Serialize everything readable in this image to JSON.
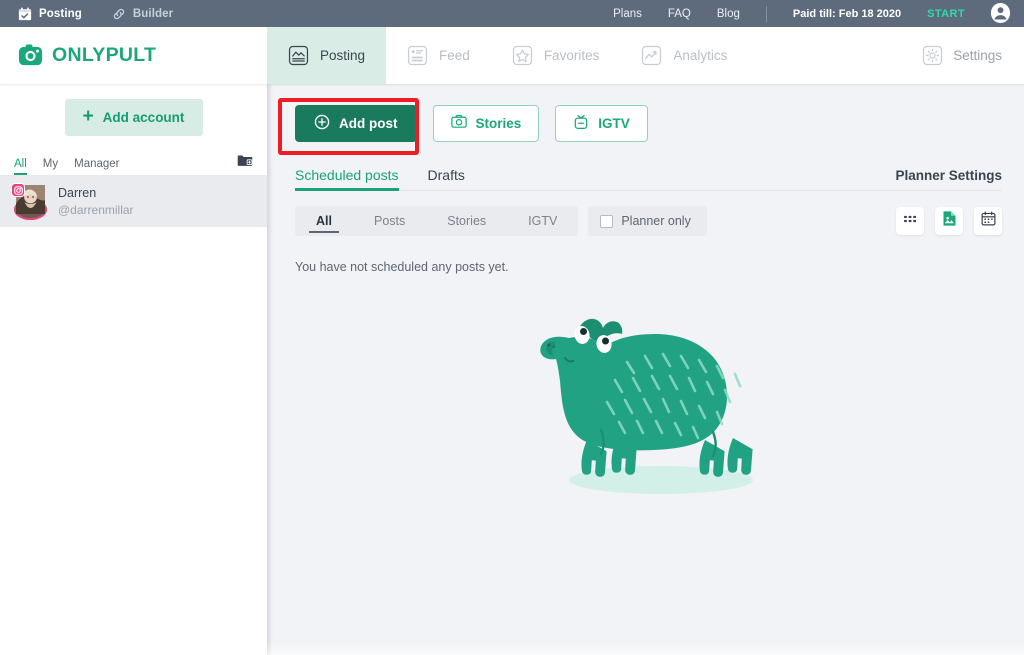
{
  "topbar": {
    "left_items": [
      {
        "label": "Posting",
        "icon": "calendar-check-icon",
        "active": true
      },
      {
        "label": "Builder",
        "icon": "link-chain-icon",
        "active": false
      }
    ],
    "links": [
      "Plans",
      "FAQ",
      "Blog"
    ],
    "plans_label": "Plans",
    "faq_label": "FAQ",
    "blog_label": "Blog",
    "paid_till": "Paid till: Feb 18 2020",
    "start_label": "START",
    "avatar_icon": "user-circle-icon",
    "bg_color": "#5d6b7d",
    "start_color": "#2fdca6"
  },
  "brand": {
    "name": "ONLYPULT",
    "icon": "instagram-camera-icon",
    "color": "#1aa87a"
  },
  "nav": {
    "tabs": [
      {
        "label": "Posting",
        "icon": "chart-frame-icon",
        "active": true
      },
      {
        "label": "Feed",
        "icon": "feed-list-icon",
        "active": false
      },
      {
        "label": "Favorites",
        "icon": "star-frame-icon",
        "active": false
      },
      {
        "label": "Analytics",
        "icon": "trend-line-icon",
        "active": false
      }
    ],
    "settings": {
      "label": "Settings",
      "icon": "gear-icon"
    },
    "active_bg": "#d9ece6"
  },
  "sidebar": {
    "add_account_label": "Add account",
    "add_account_icon": "plus-icon",
    "filter_tabs": [
      {
        "label": "All",
        "active": true
      },
      {
        "label": "My",
        "active": false
      },
      {
        "label": "Manager",
        "active": false
      }
    ],
    "folder_icon": "folder-add-icon",
    "accounts": [
      {
        "name": "Darren",
        "handle": "@darrenmillar",
        "network_icon": "instagram-badge-icon",
        "selected": true
      }
    ]
  },
  "main": {
    "actions": [
      {
        "label": "Add post",
        "icon": "plus-circle-icon",
        "style": "primary",
        "highlighted": true
      },
      {
        "label": "Stories",
        "icon": "camera-icon",
        "style": "ghost",
        "highlighted": false
      },
      {
        "label": "IGTV",
        "icon": "igtv-icon",
        "style": "ghost",
        "highlighted": false
      }
    ],
    "page_tabs": [
      {
        "label": "Scheduled posts",
        "active": true
      },
      {
        "label": "Drafts",
        "active": false
      }
    ],
    "planner_settings_label": "Planner Settings",
    "segment_filters": [
      {
        "label": "All",
        "active": true
      },
      {
        "label": "Posts",
        "active": false
      },
      {
        "label": "Stories",
        "active": false
      },
      {
        "label": "IGTV",
        "active": false
      }
    ],
    "planner_only": {
      "label": "Planner only",
      "checked": false
    },
    "view_modes": [
      {
        "icon": "grid-dots-icon",
        "active": false
      },
      {
        "icon": "document-image-icon",
        "active": true
      },
      {
        "icon": "calendar-icon",
        "active": false
      }
    ],
    "empty_message": "You have not scheduled any posts yet.",
    "illustration": {
      "name": "capybara-illustration",
      "color": "#21a383"
    }
  },
  "highlight": {
    "color": "#ee1c25",
    "target": "add-post-button"
  }
}
